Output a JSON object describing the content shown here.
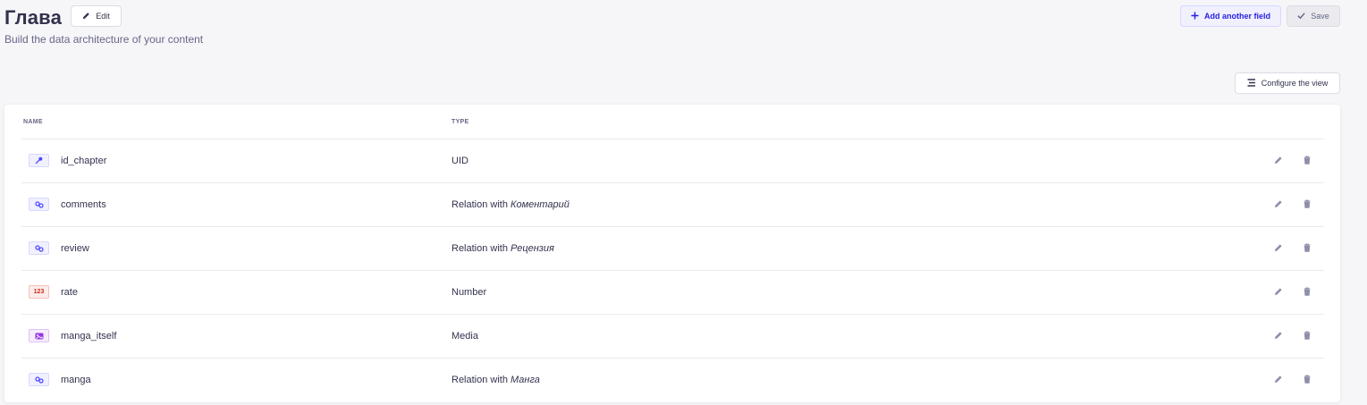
{
  "header": {
    "title": "Глава",
    "subtitle": "Build the data architecture of your content",
    "edit_label": "Edit",
    "add_field_label": "Add another field",
    "save_label": "Save"
  },
  "toolbar": {
    "configure_label": "Configure the view"
  },
  "table": {
    "columns": {
      "name": "NAME",
      "type": "TYPE"
    },
    "rows": [
      {
        "icon": "key-icon",
        "name": "id_chapter",
        "type": "UID",
        "target": ""
      },
      {
        "icon": "relation-icon",
        "name": "comments",
        "type": "Relation with",
        "target": "Коментарий"
      },
      {
        "icon": "relation-icon",
        "name": "review",
        "type": "Relation with",
        "target": "Рецензия"
      },
      {
        "icon": "number-icon",
        "name": "rate",
        "type": "Number",
        "target": "",
        "icon_text": "123"
      },
      {
        "icon": "media-icon",
        "name": "manga_itself",
        "type": "Media",
        "target": ""
      },
      {
        "icon": "relation-icon",
        "name": "manga",
        "type": "Relation with",
        "target": "Манга"
      }
    ]
  },
  "colors": {
    "background": "#f6f6f9",
    "primary": "#4945ff",
    "number": "#d02b20",
    "media": "#9736e8"
  }
}
